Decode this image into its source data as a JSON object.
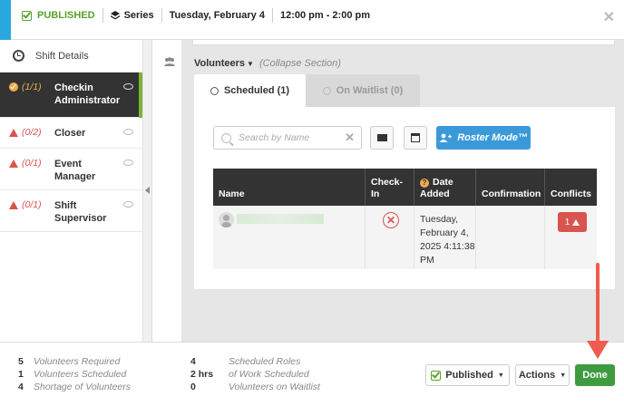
{
  "header": {
    "status": "PUBLISHED",
    "series": "Series",
    "date": "Tuesday, February 4",
    "time": "12:00 pm - 2:00 pm"
  },
  "sidebar": {
    "shift_details": "Shift Details",
    "roles": [
      {
        "count": "(1/1)",
        "name": "Checkin Administrator",
        "state": "filled"
      },
      {
        "count": "(0/2)",
        "name": "Closer",
        "state": "short"
      },
      {
        "count": "(0/1)",
        "name": "Event Manager",
        "state": "short"
      },
      {
        "count": "(0/1)",
        "name": "Shift Supervisor",
        "state": "short"
      }
    ]
  },
  "volunteers": {
    "title": "Volunteers",
    "collapse": "(Collapse Section)",
    "tabs": [
      {
        "label": "Scheduled (1)"
      },
      {
        "label": "On Waitlist (0)"
      }
    ],
    "search_placeholder": "Search by Name",
    "roster_mode": "Roster Mode™",
    "table": {
      "headers": [
        "Name",
        "Check-In",
        "Date Added",
        "Confirmation",
        "Conflicts"
      ],
      "rows": [
        {
          "date_added": "Tuesday, February 4, 2025 4:11:38 PM",
          "conflicts": "1"
        }
      ]
    }
  },
  "footer": {
    "stats_left": [
      {
        "n": "5",
        "label": "Volunteers Required"
      },
      {
        "n": "1",
        "label": "Volunteers Scheduled"
      },
      {
        "n": "4",
        "label": "Shortage of Volunteers"
      }
    ],
    "stats_right": [
      {
        "n": "4",
        "label": "Scheduled Roles"
      },
      {
        "n": "2 hrs",
        "label": "of Work Scheduled"
      },
      {
        "n": "0",
        "label": "Volunteers on Waitlist"
      }
    ],
    "published_btn": "Published",
    "actions_btn": "Actions",
    "done_btn": "Done"
  },
  "colors": {
    "accent": "#2aa7df",
    "published": "#5aa22a",
    "warn": "#d9534f",
    "primary": "#3a9ad9",
    "done": "#3f9b3f",
    "annotation": "#f05a4f"
  }
}
